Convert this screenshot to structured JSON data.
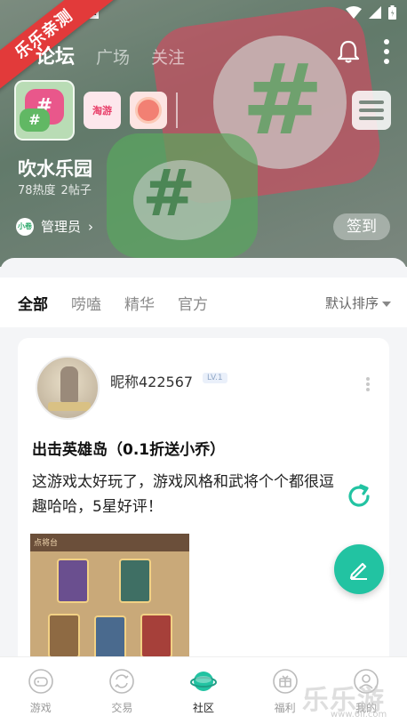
{
  "status_bar": {
    "indicator": "A"
  },
  "ribbon": {
    "text": "乐乐亲测"
  },
  "top_tabs": [
    {
      "label": "论坛",
      "active": true
    },
    {
      "label": "广场",
      "active": false
    },
    {
      "label": "关注",
      "active": false
    }
  ],
  "forum": {
    "icons": [
      {
        "name": "forum-main-icon",
        "label": "#"
      },
      {
        "name": "taoyou-icon",
        "label": "淘游"
      },
      {
        "name": "badge-icon",
        "label": ""
      }
    ],
    "name": "吹水乐园",
    "heat": "78热度",
    "posts": "2帖子",
    "admin_avatar": "小卷",
    "admin_label": "管理员",
    "signin_label": "签到"
  },
  "filter": {
    "tabs": [
      {
        "label": "全部",
        "active": true
      },
      {
        "label": "唠嗑",
        "active": false
      },
      {
        "label": "精华",
        "active": false
      },
      {
        "label": "官方",
        "active": false
      }
    ],
    "sort_label": "默认排序"
  },
  "post": {
    "author": "昵称422567",
    "level": "LV.1",
    "title": "出击英雄岛（0.1折送小乔）",
    "body": "这游戏太好玩了，游戏风格和武将个个都很逗趣哈哈，5星好评！",
    "image_caption": "点将台"
  },
  "bottom_nav": [
    {
      "label": "游戏",
      "icon": "gamepad-icon",
      "active": false
    },
    {
      "label": "交易",
      "icon": "exchange-icon",
      "active": false
    },
    {
      "label": "社区",
      "icon": "planet-icon",
      "active": true
    },
    {
      "label": "福利",
      "icon": "gift-icon",
      "active": false
    },
    {
      "label": "我的",
      "icon": "user-icon",
      "active": false
    }
  ],
  "watermark": {
    "text": "乐乐游戏",
    "url": "www.6ll.com"
  },
  "colors": {
    "accent": "#22c3a2",
    "ribbon": "#e23a3a"
  }
}
